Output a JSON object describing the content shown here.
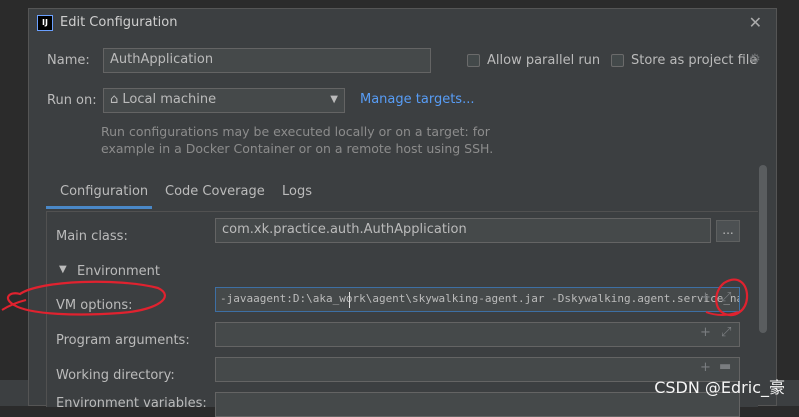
{
  "window": {
    "title": "Edit Configuration",
    "app_icon": "IJ",
    "close_icon": "close-icon"
  },
  "name": {
    "label": "Name:",
    "value": "AuthApplication"
  },
  "allow_parallel": {
    "label": "Allow parallel run",
    "checked": false
  },
  "store_project_file": {
    "label": "Store as project file",
    "checked": false,
    "icon": "gear-icon"
  },
  "run_on": {
    "label": "Run on:",
    "selected": "Local machine",
    "icon": "home-icon",
    "manage_link": "Manage targets..."
  },
  "hint": {
    "line1": "Run configurations may be executed locally or on a target: for",
    "line2": "example in a Docker Container or on a remote host using SSH."
  },
  "tabs": [
    {
      "label": "Configuration",
      "active": true
    },
    {
      "label": "Code Coverage",
      "active": false
    },
    {
      "label": "Logs",
      "active": false
    }
  ],
  "main_class": {
    "label": "Main class:",
    "value": "com.xk.practice.auth.AuthApplication",
    "browse": "..."
  },
  "environment": {
    "label": "Environment",
    "expanded": true
  },
  "vm_options": {
    "label": "VM options:",
    "value": "-javaagent:D:\\aka_work\\agent\\skywalking-agent.jar -Dskywalking.agent.service_na"
  },
  "program_arguments": {
    "label": "Program arguments:",
    "value": ""
  },
  "working_directory": {
    "label": "Working directory:",
    "value": ""
  },
  "environment_variables": {
    "label": "Environment variables:"
  },
  "watermark": "CSDN @Edric_豪",
  "colors": {
    "accent": "#4a88c7",
    "link": "#589df6",
    "annotation": "#e0222f"
  }
}
